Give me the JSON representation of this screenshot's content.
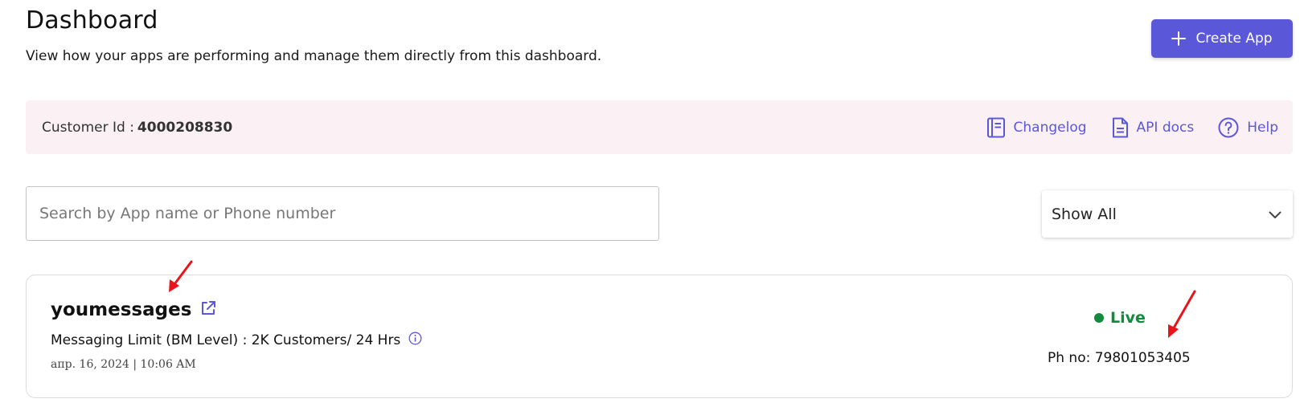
{
  "header": {
    "title": "Dashboard",
    "subtitle": "View how your apps are performing and manage them directly from this dashboard.",
    "create_button_label": "Create App"
  },
  "info_bar": {
    "customer_label": "Customer Id :",
    "customer_id": "4000208830",
    "links": [
      {
        "label": "Changelog",
        "icon": "book-icon"
      },
      {
        "label": "API docs",
        "icon": "document-icon"
      },
      {
        "label": "Help",
        "icon": "help-circle-icon"
      }
    ]
  },
  "filters": {
    "search_placeholder": "Search by App name or Phone number",
    "search_value": "",
    "status_filter_selected": "Show All"
  },
  "apps": [
    {
      "name": "youmessages",
      "messaging_limit": "Messaging Limit (BM Level) : 2K Customers/ 24 Hrs",
      "created": "апр. 16, 2024 | 10:06 AM",
      "status": "Live",
      "phone": "Ph no: 79801053405"
    }
  ],
  "colors": {
    "accent": "#5b57d9",
    "info_bar_bg": "#fbf1f5",
    "live_green": "#138a3e",
    "annotation_arrow": "#e8141b"
  }
}
